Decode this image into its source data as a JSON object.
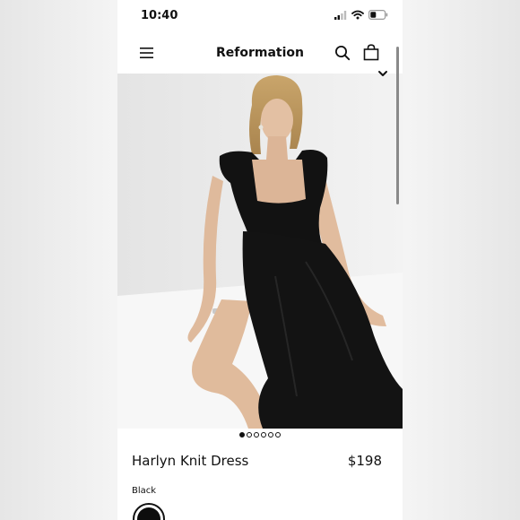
{
  "status_bar": {
    "time": "10:40"
  },
  "nav": {
    "title": "Reformation",
    "icons": [
      "menu-icon",
      "search-icon",
      "shopping-bag-icon"
    ]
  },
  "gallery": {
    "page_count": 6,
    "active_index": 0,
    "image_description": "Model with blonde hair wearing a black cap-sleeve square-neck maxi dress with a thigh-high slit, seated on a white floor"
  },
  "product": {
    "name": "Harlyn Knit Dress",
    "price": "$198",
    "color_label": "Black",
    "selected_swatch_color": "#0d0d0d"
  }
}
